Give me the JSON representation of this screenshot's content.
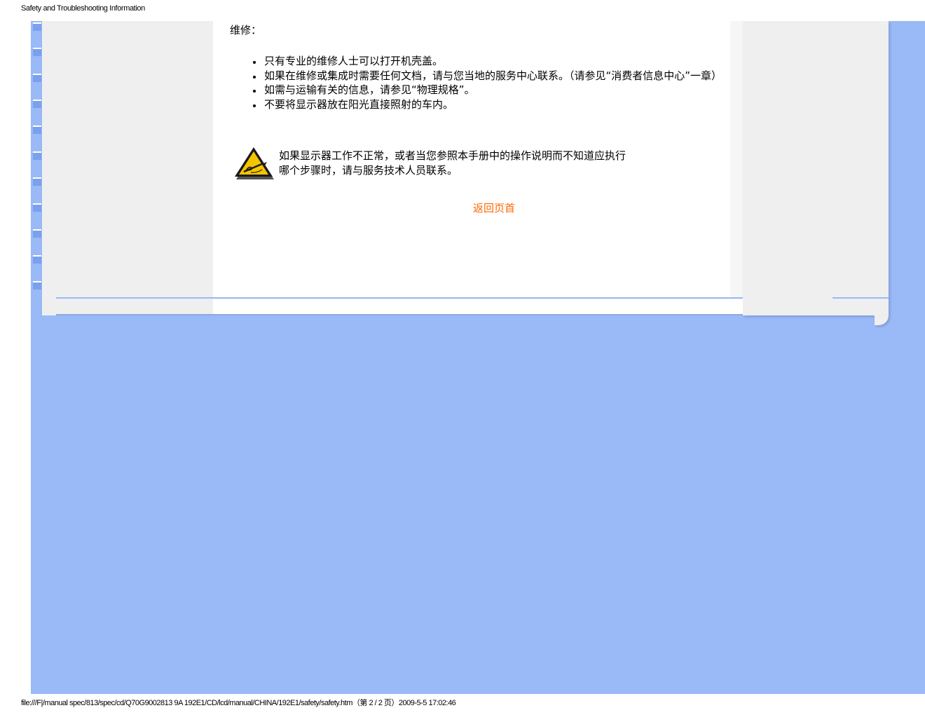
{
  "header": {
    "title": "Safety and Troubleshooting Information"
  },
  "content": {
    "heading": "维修：",
    "bullets": [
      "只有专业的维修人士可以打开机壳盖。",
      "如果在维修或集成时需要任何文档，请与您当地的服务中心联系。（请参见“消费者信息中心”一章）",
      "如需与运输有关的信息，请参见“物理规格”。",
      "不要将显示器放在阳光直接照射的车内。"
    ],
    "warning": {
      "line1": "如果显示器工作不正常，或者当您参照本手册中的操作说明而不知道应执行",
      "line2": "哪个步骤时，请与服务技术人员联系。"
    },
    "back_link": "返回页首"
  },
  "footer": {
    "path": "file:///F|/manual spec/813/spec/cd/Q70G9002813 9A 192E1/CD/lcd/manual/CHINA/192E1/safety/safety.htm（第 2 / 2 页）2009-5-5 17:02:46"
  },
  "colors": {
    "background_blue": "#99b9f7",
    "panel_gray": "#efefef",
    "link_orange": "#ff6600",
    "warning_yellow": "#f5c400"
  },
  "icons": {
    "warning": "warning-pen-icon"
  }
}
